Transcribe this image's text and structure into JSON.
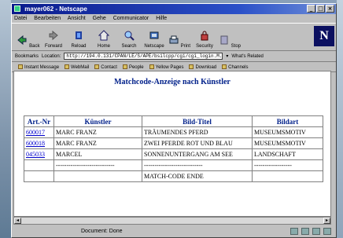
{
  "window": {
    "title": "mayer062 - Netscape"
  },
  "menu": [
    "Datei",
    "Bearbeiten",
    "Ansicht",
    "Gehe",
    "Communicator",
    "Hilfe"
  ],
  "toolbar": [
    {
      "label": "Back",
      "icon": "back-arrow-icon"
    },
    {
      "label": "Forward",
      "icon": "forward-arrow-icon"
    },
    {
      "label": "Reload",
      "icon": "reload-icon"
    },
    {
      "label": "Home",
      "icon": "home-icon"
    },
    {
      "label": "Search",
      "icon": "search-icon"
    },
    {
      "label": "Netscape",
      "icon": "netscape-icon"
    },
    {
      "label": "Print",
      "icon": "print-icon"
    },
    {
      "label": "Security",
      "icon": "security-icon"
    },
    {
      "label": "Stop",
      "icon": "stop-icon"
    }
  ],
  "location": {
    "bookmarks_label": "Bookmarks",
    "location_label": "Location:",
    "url": "http://194.0.131/CPAN/LE/S/APE/bsilcpp/cgi/cgi_login.M.NPM/M...?",
    "whats_related": "What's Related"
  },
  "links": [
    "Instant Message",
    "WebMail",
    "Contact",
    "People",
    "Yellow Pages",
    "Download",
    "Channels"
  ],
  "page": {
    "heading": "Matchcode-Anzeige nach Künstler",
    "columns": [
      "Art.-Nr",
      "Künstler",
      "Bild-Titel",
      "Bildart"
    ],
    "rows": [
      {
        "nr": "600017",
        "artist": "MARC FRANZ",
        "title": "TRÄUMENDES PFERD",
        "type": "MUSEUMSMOTIV"
      },
      {
        "nr": "600018",
        "artist": "MARC FRANZ",
        "title": "ZWEI PFERDE ROT UND BLAU",
        "type": "MUSEUMSMOTIV"
      },
      {
        "nr": "045033",
        "artist": "MARCEL",
        "title": "SONNENUNTERGANG AM SEE",
        "type": "LANDSCHAFT"
      },
      {
        "nr": "",
        "artist": "----------------------------",
        "title": "----------------------------",
        "type": "------------------"
      },
      {
        "nr": "",
        "artist": "",
        "title": "MATCH-CODE ENDE",
        "type": ""
      }
    ]
  },
  "status": {
    "text": "Document: Done"
  }
}
